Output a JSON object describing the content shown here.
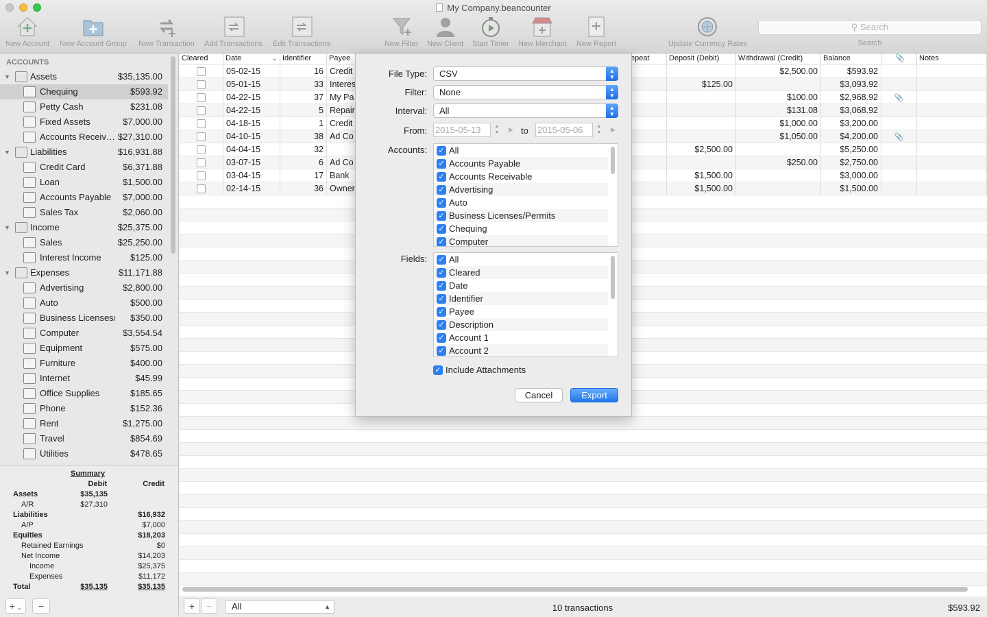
{
  "window": {
    "title": "My Company.beancounter"
  },
  "toolbar": {
    "new_account": "New Account",
    "new_account_group": "New Account Group",
    "new_transaction": "New Transaction",
    "add_transactions": "Add Transactions",
    "edit_transactions": "Edit Transactions",
    "new_filter": "New Filter",
    "new_client": "New Client",
    "start_timer": "Start Timer",
    "new_merchant": "New Merchant",
    "new_report": "New Report",
    "update_currency_rates": "Update Currency Rates",
    "search_placeholder": "Search",
    "search_caption": "Search"
  },
  "sidebar": {
    "header": "ACCOUNTS",
    "items": [
      {
        "name": "Assets",
        "value": "$35,135.00",
        "group": true
      },
      {
        "name": "Chequing",
        "value": "$593.92",
        "selected": true
      },
      {
        "name": "Petty Cash",
        "value": "$231.08"
      },
      {
        "name": "Fixed Assets",
        "value": "$7,000.00"
      },
      {
        "name": "Accounts Receiv…",
        "value": "$27,310.00"
      },
      {
        "name": "Liabilities",
        "value": "$16,931.88",
        "group": true
      },
      {
        "name": "Credit Card",
        "value": "$6,371.88"
      },
      {
        "name": "Loan",
        "value": "$1,500.00"
      },
      {
        "name": "Accounts Payable",
        "value": "$7,000.00"
      },
      {
        "name": "Sales Tax",
        "value": "$2,060.00"
      },
      {
        "name": "Income",
        "value": "$25,375.00",
        "group": true
      },
      {
        "name": "Sales",
        "value": "$25,250.00"
      },
      {
        "name": "Interest Income",
        "value": "$125.00"
      },
      {
        "name": "Expenses",
        "value": "$11,171.88",
        "group": true
      },
      {
        "name": "Advertising",
        "value": "$2,800.00"
      },
      {
        "name": "Auto",
        "value": "$500.00"
      },
      {
        "name": "Business Licenses/…",
        "value": "$350.00"
      },
      {
        "name": "Computer",
        "value": "$3,554.54"
      },
      {
        "name": "Equipment",
        "value": "$575.00"
      },
      {
        "name": "Furniture",
        "value": "$400.00"
      },
      {
        "name": "Internet",
        "value": "$45.99"
      },
      {
        "name": "Office Supplies",
        "value": "$185.65"
      },
      {
        "name": "Phone",
        "value": "$152.36"
      },
      {
        "name": "Rent",
        "value": "$1,275.00"
      },
      {
        "name": "Travel",
        "value": "$854.69"
      },
      {
        "name": "Utilities",
        "value": "$478.65"
      }
    ]
  },
  "summary": {
    "title": "Summary",
    "col_debit": "Debit",
    "col_credit": "Credit",
    "rows": [
      {
        "label": "Assets",
        "debit": "$35,135",
        "credit": "",
        "bold": true,
        "indent": 0
      },
      {
        "label": "A/R",
        "debit": "$27,310",
        "credit": "",
        "bold": false,
        "indent": 1
      },
      {
        "label": "Liabilities",
        "debit": "",
        "credit": "$16,932",
        "bold": true,
        "indent": 0
      },
      {
        "label": "A/P",
        "debit": "",
        "credit": "$7,000",
        "bold": false,
        "indent": 1
      },
      {
        "label": "Equities",
        "debit": "",
        "credit": "$18,203",
        "bold": true,
        "indent": 0
      },
      {
        "label": "Retained Earnings",
        "debit": "",
        "credit": "$0",
        "bold": false,
        "indent": 1
      },
      {
        "label": "Net Income",
        "debit": "",
        "credit": "$14,203",
        "bold": false,
        "indent": 1
      },
      {
        "label": "Income",
        "debit": "",
        "credit": "$25,375",
        "bold": false,
        "indent": 2
      },
      {
        "label": "Expenses",
        "debit": "",
        "credit": "$11,172",
        "bold": false,
        "indent": 2
      },
      {
        "label": "Total",
        "debit": "$35,135",
        "credit": "$35,135",
        "bold": true,
        "indent": 0,
        "underline": true
      }
    ]
  },
  "table": {
    "columns": {
      "cleared": "Cleared",
      "date": "Date",
      "identifier": "Identifier",
      "payee": "Payee",
      "repeat": "epeat",
      "deposit": "Deposit (Debit)",
      "withdrawal": "Withdrawal (Credit)",
      "balance": "Balance",
      "notes": "Notes"
    },
    "rows": [
      {
        "date": "05-02-15",
        "id": "16",
        "payee": "Credit",
        "deposit": "",
        "withdrawal": "$2,500.00",
        "balance": "$593.92",
        "attach": false
      },
      {
        "date": "05-01-15",
        "id": "33",
        "payee": "Interes",
        "deposit": "$125.00",
        "withdrawal": "",
        "balance": "$3,093.92",
        "attach": false
      },
      {
        "date": "04-22-15",
        "id": "37",
        "payee": "My Pa",
        "deposit": "",
        "withdrawal": "$100.00",
        "balance": "$2,968.92",
        "attach": true
      },
      {
        "date": "04-22-15",
        "id": "5",
        "payee": "Repair",
        "deposit": "",
        "withdrawal": "$131.08",
        "balance": "$3,068.92",
        "attach": false
      },
      {
        "date": "04-18-15",
        "id": "1",
        "payee": "Credit",
        "deposit": "",
        "withdrawal": "$1,000.00",
        "balance": "$3,200.00",
        "attach": false
      },
      {
        "date": "04-10-15",
        "id": "38",
        "payee": "Ad Co",
        "deposit": "",
        "withdrawal": "$1,050.00",
        "balance": "$4,200.00",
        "attach": true
      },
      {
        "date": "04-04-15",
        "id": "32",
        "payee": "",
        "deposit": "$2,500.00",
        "withdrawal": "",
        "balance": "$5,250.00",
        "attach": false
      },
      {
        "date": "03-07-15",
        "id": "6",
        "payee": "Ad Co",
        "deposit": "",
        "withdrawal": "$250.00",
        "balance": "$2,750.00",
        "attach": false
      },
      {
        "date": "03-04-15",
        "id": "17",
        "payee": "Bank",
        "deposit": "$1,500.00",
        "withdrawal": "",
        "balance": "$3,000.00",
        "attach": false
      },
      {
        "date": "02-14-15",
        "id": "36",
        "payee": "Owner",
        "deposit": "$1,500.00",
        "withdrawal": "",
        "balance": "$1,500.00",
        "attach": false
      }
    ]
  },
  "dialog": {
    "file_type_label": "File Type:",
    "file_type_value": "CSV",
    "filter_label": "Filter:",
    "filter_value": "None",
    "interval_label": "Interval:",
    "interval_value": "All",
    "from_label": "From:",
    "from_value": "2015-05-13",
    "to_label": "to",
    "to_value": "2015-05-06",
    "accounts_label": "Accounts:",
    "accounts": [
      "All",
      "Accounts Payable",
      "Accounts Receivable",
      "Advertising",
      "Auto",
      "Business Licenses/Permits",
      "Chequing",
      "Computer"
    ],
    "fields_label": "Fields:",
    "fields": [
      "All",
      "Cleared",
      "Date",
      "Identifier",
      "Payee",
      "Description",
      "Account 1",
      "Account 2"
    ],
    "include_attachments": "Include Attachments",
    "cancel": "Cancel",
    "export": "Export"
  },
  "bottom": {
    "add": "+",
    "remove": "−",
    "filter_value": "All",
    "transaction_count": "10 transactions",
    "balance": "$593.92"
  }
}
